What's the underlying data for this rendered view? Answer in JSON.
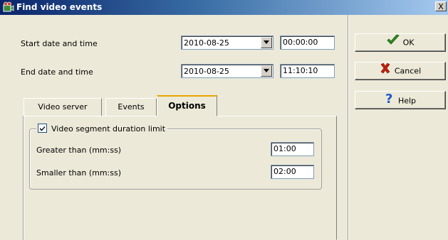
{
  "window": {
    "title": "Find video events",
    "close_glyph": "X"
  },
  "form": {
    "start_label": "Start date and time",
    "start_date": "2010-08-25",
    "start_time": "00:00:00",
    "end_label": "End date and time",
    "end_date": "2010-08-25",
    "end_time": "11:10:10"
  },
  "buttons": {
    "ok": "OK",
    "cancel": "Cancel",
    "help": "Help"
  },
  "tabs": [
    {
      "label": "Video server",
      "active": false
    },
    {
      "label": "Events",
      "active": false
    },
    {
      "label": "Options",
      "active": true
    }
  ],
  "options": {
    "group_label": "Video segment duration limit",
    "group_checked": true,
    "greater_label": "Greater than (mm:ss)",
    "greater_value": "01:00",
    "smaller_label": "Smaller than (mm:ss)",
    "smaller_value": "02:00"
  },
  "icons": {
    "app": "film-camera-icon",
    "ok": "checkmark-icon",
    "cancel": "x-mark-icon",
    "help": "question-mark-icon",
    "dropdown": "chevron-down-icon"
  },
  "colors": {
    "title_bar_start": "#0a246a",
    "dialog_bg": "#ece9d8",
    "ok_green": "#2e8b1f",
    "cancel_red": "#c0200a",
    "help_blue": "#1c58c8",
    "tab_active_accent": "#e6a400"
  }
}
